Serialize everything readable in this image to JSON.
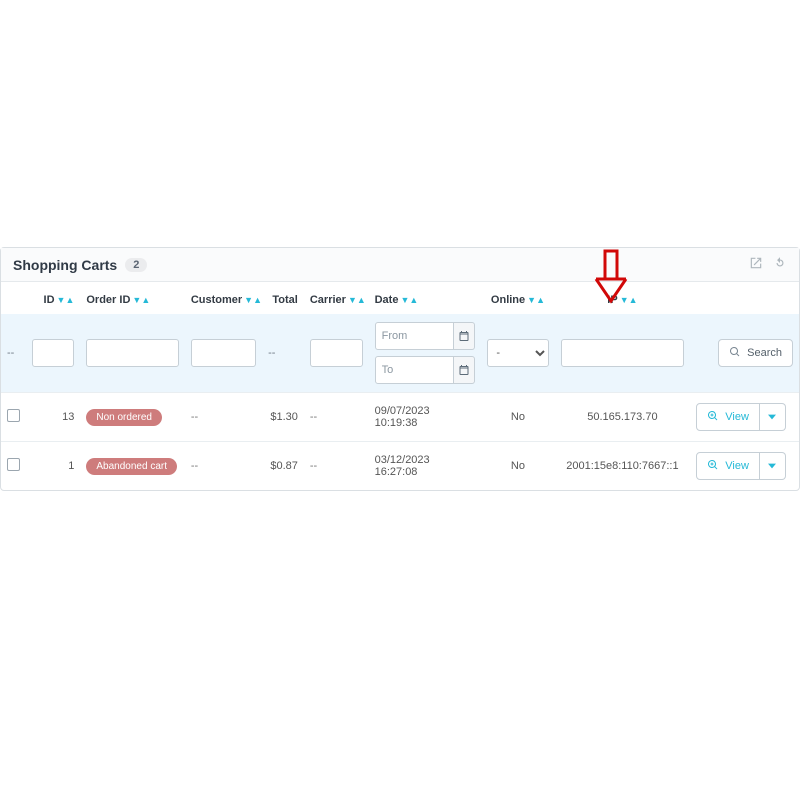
{
  "header": {
    "title": "Shopping Carts",
    "count": "2"
  },
  "columns": {
    "id": "ID",
    "order_id": "Order ID",
    "customer": "Customer",
    "total": "Total",
    "carrier": "Carrier",
    "date": "Date",
    "online": "Online",
    "ip": "IP"
  },
  "filter": {
    "dash": "--",
    "from_ph": "From",
    "to_ph": "To",
    "online_default": "-",
    "search_label": "Search"
  },
  "view_label": "View",
  "rows": [
    {
      "id": "13",
      "order_badge": "Non ordered",
      "customer": "--",
      "total": "$1.30",
      "carrier": "--",
      "date": "09/07/2023 10:19:38",
      "online": "No",
      "ip": "50.165.173.70"
    },
    {
      "id": "1",
      "order_badge": "Abandoned cart",
      "customer": "--",
      "total": "$0.87",
      "carrier": "--",
      "date": "03/12/2023 16:27:08",
      "online": "No",
      "ip": "2001:15e8:110:7667::1"
    }
  ]
}
